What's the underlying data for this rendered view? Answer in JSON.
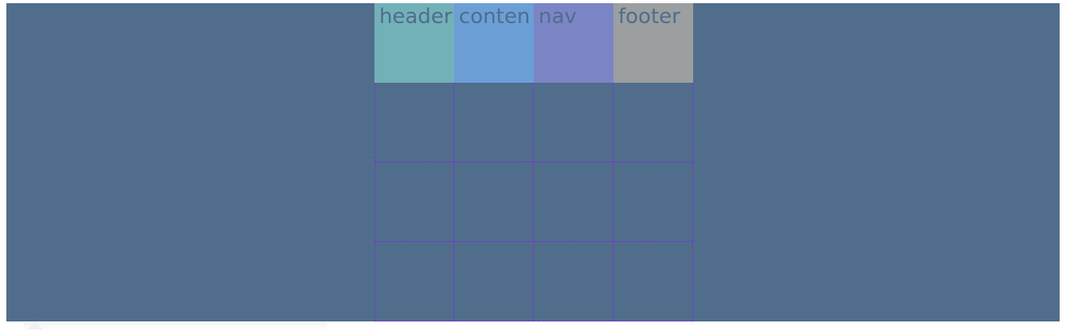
{
  "grid": {
    "areas": [
      {
        "name": "header",
        "color": "#72b1b8"
      },
      {
        "name": "conten",
        "color": "#6b9fd6"
      },
      {
        "name": "nav",
        "color": "#7b85c6"
      },
      {
        "name": "footer",
        "color": "#9b9fa0"
      }
    ],
    "rows": 4,
    "columns": 4,
    "grid_line_color": "#7a2fe0",
    "background_color": "#506d8c"
  }
}
